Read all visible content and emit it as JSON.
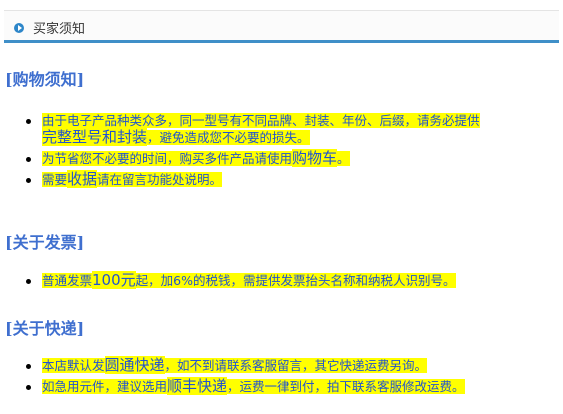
{
  "header": {
    "title": "买家须知"
  },
  "sections": [
    {
      "title": "[购物须知]",
      "items": [
        {
          "text1": "由于电子产品种类众多，同一型号有不同品牌、封装、年份、后缀，请务必提供",
          "big": "完整型号和封装",
          "text2": "，避免造成您不必要的损失。"
        },
        {
          "text1": "为节省您不必要的时间，购买多件产品请使用",
          "big": "购物车",
          "text2": "。"
        },
        {
          "text1": "需要",
          "big": "收据",
          "text2": "请在留言功能处说明。"
        }
      ]
    },
    {
      "title": "[关于发票]",
      "items": [
        {
          "text1": "普通发票",
          "big": "100元",
          "text2": "起，加6%的税钱，需提供发票抬头名称和纳税人识别号。"
        }
      ]
    },
    {
      "title": "[关于快递]",
      "items": [
        {
          "text1": "本店默认发",
          "big": "圆通快递",
          "text2": "，如不到请联系客服留言，其它快递运费另询。"
        },
        {
          "text1": "如急用元件，建议选用",
          "big": "顺丰快递",
          "text2": "，运费一律到付，拍下联系客服修改运费。"
        }
      ]
    }
  ]
}
